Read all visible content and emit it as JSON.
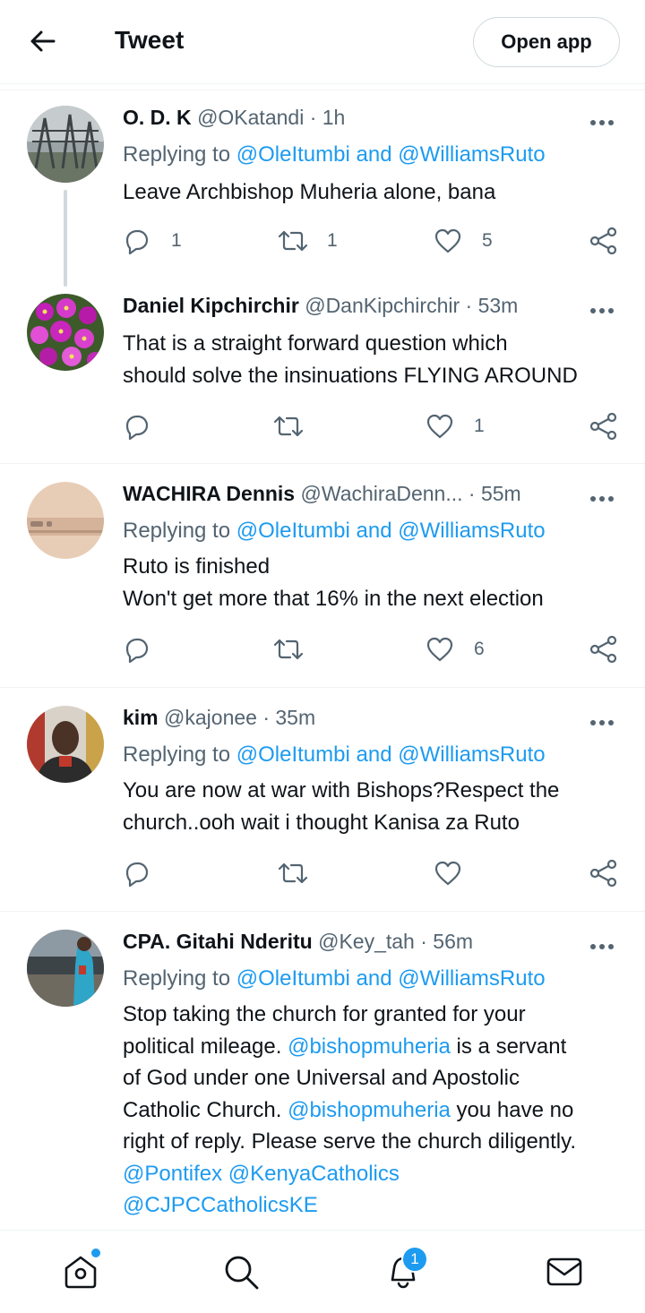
{
  "header": {
    "title": "Tweet",
    "open_app_label": "Open app"
  },
  "tweets": [
    {
      "name": "O. D. K",
      "handle": "@OKatandi",
      "time": "· 1h",
      "replying_prefix": "Replying to ",
      "replying_to_1": "@OleItumbi",
      "replying_and": " and ",
      "replying_to_2": "@WilliamsRuto",
      "text": "Leave Archbishop Muheria alone, bana",
      "replies": "1",
      "retweets": "1",
      "likes": "5"
    },
    {
      "name": "Daniel Kipchirchir",
      "handle": "@DanKipchirchir",
      "time": "· 53m",
      "line1": "That is a straight forward question which",
      "line2": "should solve the insinuations FLYING AROUND",
      "likes": "1"
    },
    {
      "name": "WACHIRA Dennis",
      "handle": "@WachiraDenn...",
      "time": "· 55m",
      "replying_prefix": "Replying to ",
      "replying_to_1": "@OleItumbi",
      "replying_and": " and ",
      "replying_to_2": "@WilliamsRuto",
      "line1": "Ruto is finished",
      "line2": "Won't get more that 16% in the next election",
      "likes": "6"
    },
    {
      "name": "kim",
      "handle": "@kajonee",
      "time": "· 35m",
      "replying_prefix": "Replying to ",
      "replying_to_1": "@OleItumbi",
      "replying_and": " and ",
      "replying_to_2": "@WilliamsRuto",
      "line1": "You are now at war with Bishops?Respect the",
      "line2": "church..ooh wait i thought Kanisa za Ruto"
    },
    {
      "name": "CPA. Gitahi Nderitu",
      "handle": "@Key_tah",
      "time": "· 56m",
      "replying_prefix": "Replying to ",
      "replying_to_1": "@OleItumbi",
      "replying_and": " and ",
      "replying_to_2": "@WilliamsRuto",
      "l1": "Stop taking the church for granted for your",
      "l2a": "political mileage. ",
      "l2m": "@bishopmuheria",
      "l2b": " is a servant",
      "l3": "of God under one Universal and Apostolic",
      "l4a": "Catholic Church. ",
      "l4m": "@bishopmuheria",
      "l4b": " you have no",
      "l5": "right of reply. Please serve the church diligently.",
      "l6a": "@Pontifex",
      "l6sp": " ",
      "l6b": "@KenyaCatholics",
      "l7": "@CJPCCatholicsKE"
    }
  ],
  "bottom_nav": {
    "notifications_badge": "1"
  },
  "colors": {
    "accent": "#1d9bf0",
    "text": "#0f1419",
    "secondary": "#536471",
    "border": "#eff3f4"
  }
}
